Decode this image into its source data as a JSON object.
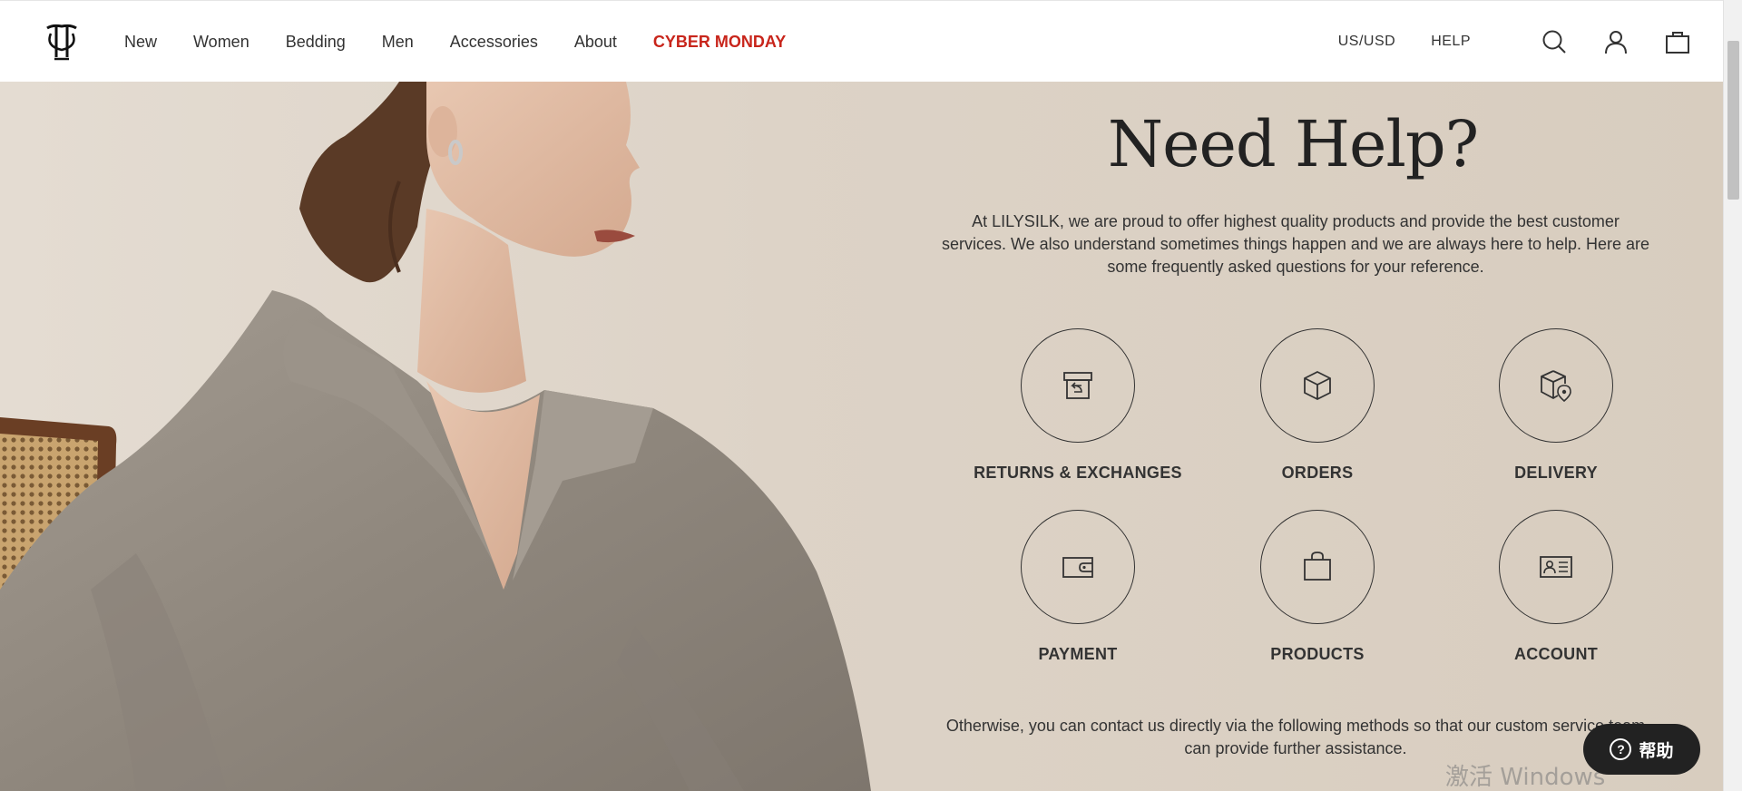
{
  "header": {
    "logo_icon": "lilysilk-monogram-icon",
    "nav": [
      {
        "label": "New"
      },
      {
        "label": "Women"
      },
      {
        "label": "Bedding"
      },
      {
        "label": "Men"
      },
      {
        "label": "Accessories"
      },
      {
        "label": "About"
      },
      {
        "label": "CYBER MONDAY",
        "color": "#c8251b"
      }
    ],
    "region_label": "US/USD",
    "help_label": "HELP",
    "icons": [
      "search-icon",
      "account-icon",
      "cart-icon"
    ]
  },
  "hero": {
    "title": "Need Help?",
    "intro": "At LILYSILK, we are proud to offer highest quality products and provide the best customer services. We also understand sometimes things happen and we are always here to help. Here are some frequently asked questions for your reference.",
    "categories": [
      {
        "label": "RETURNS & EXCHANGES",
        "icon": "return-box-icon"
      },
      {
        "label": "ORDERS",
        "icon": "package-icon"
      },
      {
        "label": "DELIVERY",
        "icon": "delivery-location-icon"
      },
      {
        "label": "PAYMENT",
        "icon": "wallet-icon"
      },
      {
        "label": "PRODUCTS",
        "icon": "shopping-bag-icon"
      },
      {
        "label": "ACCOUNT",
        "icon": "id-card-icon"
      }
    ],
    "contact": "Otherwise, you can contact us directly via the following methods so that our custom service team can provide further assistance."
  },
  "help_button": {
    "label": "帮助",
    "icon": "question-circle-icon"
  },
  "watermark": "激活 Windows",
  "colors": {
    "accent": "#c8251b",
    "background": "#ddd2c6",
    "dark": "#222222"
  }
}
